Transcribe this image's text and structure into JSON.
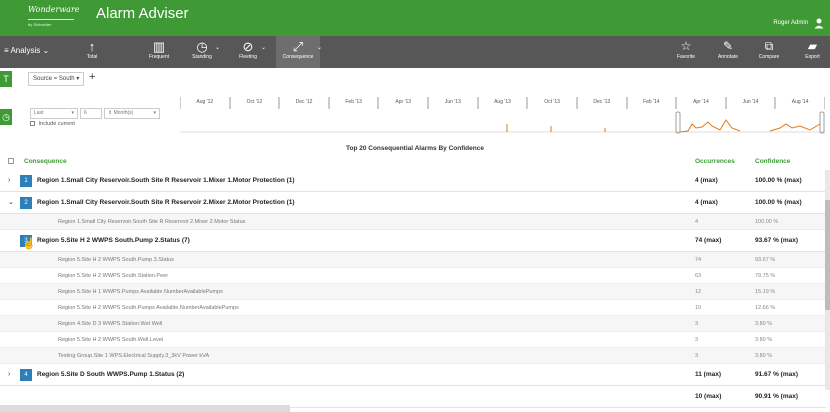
{
  "app": {
    "logo_text": "Wonderware",
    "logo_sub": "by Schneider",
    "title": "Alarm Adviser",
    "user_name": "Roger Admin"
  },
  "toolbar": {
    "analysis_label": "Analysis",
    "left_buttons": [
      {
        "label": "Total",
        "icon": "arrow-up-icon"
      },
      {
        "label": "Frequent",
        "icon": "bar-chart-icon"
      },
      {
        "label": "Standing",
        "icon": "clock-icon"
      },
      {
        "label": "Fleeting",
        "icon": "fleeting-icon"
      },
      {
        "label": "Consequence",
        "icon": "consequence-icon"
      }
    ],
    "right_buttons": [
      {
        "label": "Favorite",
        "icon": "star-icon"
      },
      {
        "label": "Annotate",
        "icon": "pencil-icon"
      },
      {
        "label": "Compare",
        "icon": "compare-icon"
      },
      {
        "label": "Export",
        "icon": "export-icon"
      }
    ]
  },
  "filter": {
    "source_label": "Source = South"
  },
  "time": {
    "range_type": "Last",
    "count": "6",
    "unit": "Month(s)",
    "include_current": "Include current",
    "months": [
      "Aug '12",
      "Oct '12",
      "Dec '12",
      "Feb '13",
      "Apr '13",
      "Jun '13",
      "Aug '13",
      "Oct '13",
      "Dec '13",
      "Feb '14",
      "Apr '14",
      "Jun '14",
      "Aug '14"
    ]
  },
  "table": {
    "title": "Top 20 Consequential Alarms By Confidence",
    "columns": {
      "consequence": "Consequence",
      "occurrences": "Occurrences",
      "confidence": "Confidence"
    },
    "rows": [
      {
        "kind": "parent",
        "toggle": "›",
        "rank": "1",
        "name": "Region 1.Small City Reservoir.South Site R Reservoir 1.Mixer 1.Motor Protection (1)",
        "occurrences": "4 (max)",
        "confidence": "100.00 % (max)"
      },
      {
        "kind": "parent",
        "toggle": "⌄",
        "rank": "2",
        "name": "Region 1.Small City Reservoir.South Site R Reservoir 2.Mixer 2.Motor Protection (1)",
        "occurrences": "4 (max)",
        "confidence": "100.00 % (max)"
      },
      {
        "kind": "child",
        "name": "Region 1.Small City Reservoir.South Site R Reservoir 2.Mixer 2.Motor Status",
        "occurrences": "4",
        "confidence": "100.00 %"
      },
      {
        "kind": "parent",
        "toggle": "",
        "rank": "3",
        "name": "Region 5.Site H 2 WWPS South.Pump 2.Status (7)",
        "occurrences": "74 (max)",
        "confidence": "93.67 % (max)"
      },
      {
        "kind": "child",
        "name": "Region 5.Site H 2 WWPS South.Pump 3.Status",
        "occurrences": "74",
        "confidence": "93.67 %"
      },
      {
        "kind": "child",
        "name": "Region 5.Site H 2 WWPS South.Station.Peer",
        "occurrences": "63",
        "confidence": "79.75 %"
      },
      {
        "kind": "child",
        "name": "Region 5.Site H 1 WWPS.Pumps Available.NumberAvailablePumps",
        "occurrences": "12",
        "confidence": "15.19 %"
      },
      {
        "kind": "child",
        "name": "Region 5.Site H 2 WWPS South.Pumps Available.NumberAvailablePumps",
        "occurrences": "10",
        "confidence": "12.66 %"
      },
      {
        "kind": "child",
        "name": "Region 4.Site D 3 WWPS.Station.Wet Well",
        "occurrences": "3",
        "confidence": "3.80 %"
      },
      {
        "kind": "child",
        "name": "Region 5.Site H 2 WWPS South.Well.Level",
        "occurrences": "3",
        "confidence": "3.80 %"
      },
      {
        "kind": "child",
        "name": "Testing Group.Site 1 WPS.Electrical Supply.3_3kV Power kVA",
        "occurrences": "3",
        "confidence": "3.80 %"
      },
      {
        "kind": "parent",
        "toggle": "›",
        "rank": "4",
        "name": "Region 5.Site D South WWPS.Pump 1.Status (2)",
        "occurrences": "11 (max)",
        "confidence": "91.67 % (max)"
      },
      {
        "kind": "parent",
        "toggle": "",
        "rank": "",
        "name": "",
        "occurrences": "10 (max)",
        "confidence": "90.91 % (max)"
      }
    ]
  },
  "colors": {
    "brand_green": "#3f9a35",
    "toolbar_gray": "#575757",
    "rank_blue": "#2c7fb8",
    "sparkline_orange": "#e07b1a"
  }
}
